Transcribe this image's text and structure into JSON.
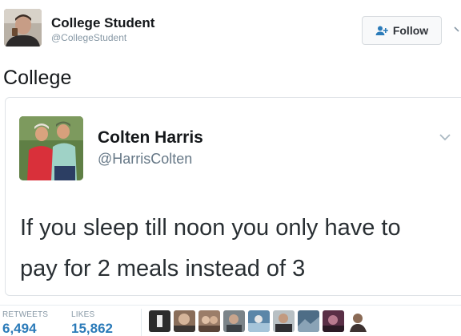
{
  "author": {
    "name": "College Student",
    "handle": "@CollegeStudent",
    "avatar_icon": "person-photo-icon"
  },
  "follow_button": {
    "label": "Follow",
    "icon": "add-user-icon"
  },
  "tweet": {
    "text": "College"
  },
  "quoted_tweet": {
    "author_name": "Colten Harris",
    "author_handle": "@HarrisColten",
    "avatar_icon": "two-people-photo-icon",
    "line1": "If you sleep till noon you only have to",
    "line2": "pay for 2 meals instead of 3"
  },
  "stats": {
    "retweets_label": "RETWEETS",
    "retweets_value": "6,494",
    "likes_label": "LIKES",
    "likes_value": "15,862"
  },
  "colors": {
    "link_blue": "#2b7bb9",
    "muted_gray": "#8899a6",
    "border": "#e1e8ed"
  }
}
